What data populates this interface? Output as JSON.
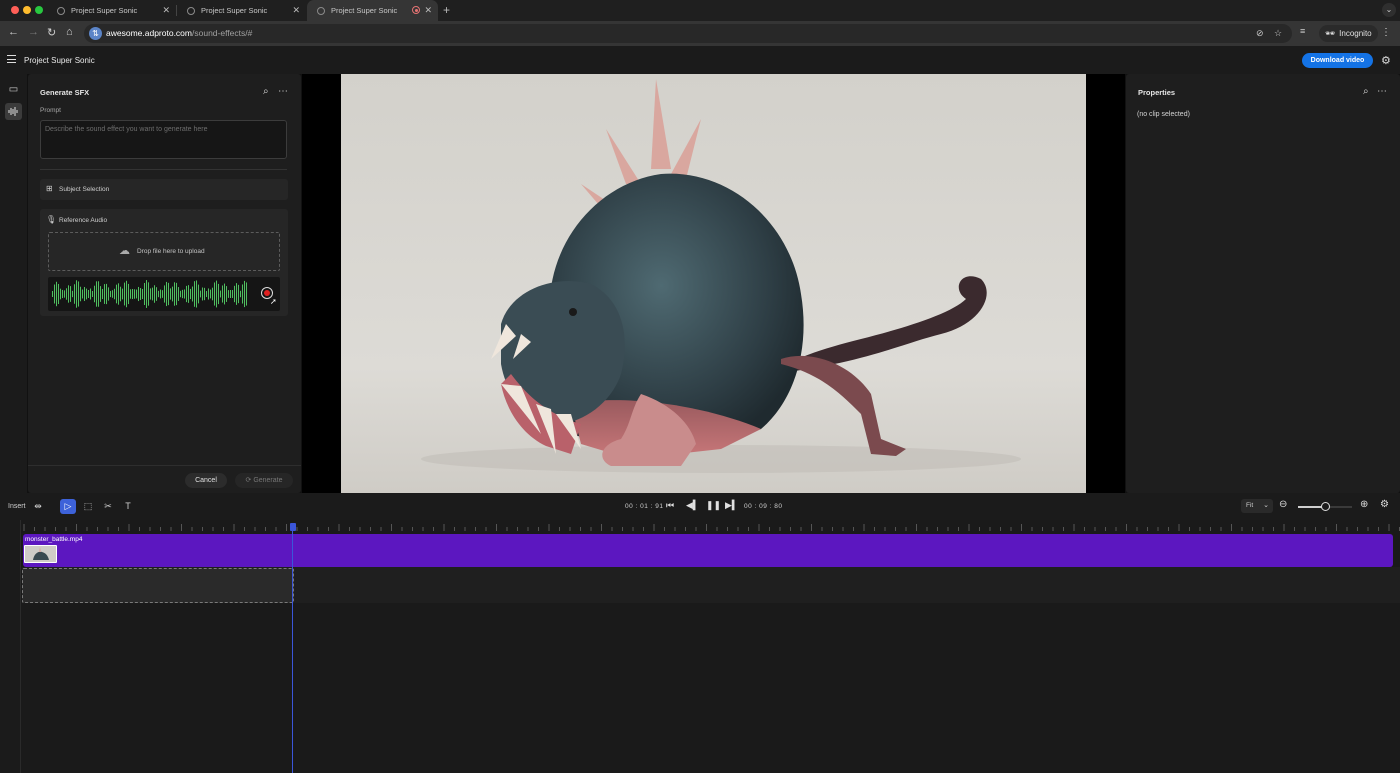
{
  "browser": {
    "tabs": [
      {
        "title": "Project Super Sonic",
        "active": false
      },
      {
        "title": "Project Super Sonic",
        "active": false
      },
      {
        "title": "Project Super Sonic",
        "active": true,
        "recording": true
      }
    ],
    "new_tab_glyph": "+",
    "url_host": "awesome.adproto.com",
    "url_path": "/sound-effects/#",
    "incognito_label": "Incognito"
  },
  "app": {
    "project_title": "Project Super Sonic",
    "download_label": "Download video",
    "accent": "#1473e6"
  },
  "sfx_panel": {
    "title": "Generate SFX",
    "prompt_label": "Prompt",
    "prompt_placeholder": "Describe the sound effect you want to generate here",
    "subject_selection_label": "Subject Selection",
    "reference_audio_label": "Reference Audio",
    "dropzone_label": "Drop file here to upload",
    "cancel_label": "Cancel",
    "generate_label": "Generate",
    "waveform_color": "#4fbf5f",
    "record_color": "#e02020"
  },
  "properties": {
    "title": "Properties",
    "empty_label": "(no clip selected)"
  },
  "timeline": {
    "insert_label": "Insert",
    "current_time": "00 : 01 : 91",
    "total_time": "00 : 09 : 80",
    "fit_label": "Fit",
    "zoom_level": 0.5,
    "clip_name": "monster_battle.mp4",
    "clip_color": "#5c17c0",
    "playhead_color": "#3b56d9"
  },
  "icons": {
    "rail": [
      "media-icon",
      "audio-waveform-icon"
    ],
    "tools": [
      "select-tool-icon",
      "trim-tool-icon",
      "cut-tool-icon",
      "text-tool-icon"
    ],
    "transport": [
      "skip-back-icon",
      "step-back-icon",
      "pause-icon",
      "step-forward-icon"
    ]
  }
}
